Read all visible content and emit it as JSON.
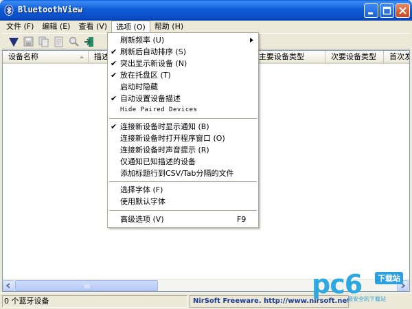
{
  "window": {
    "title": "BluetoothView"
  },
  "menubar": {
    "items": [
      {
        "label": "文件 (F)"
      },
      {
        "label": "编辑 (E)"
      },
      {
        "label": "查看 (V)"
      },
      {
        "label": "选项 (O)"
      },
      {
        "label": "帮助 (H)"
      }
    ],
    "active_index": 3
  },
  "toolbar": {
    "icons": [
      "properties-icon",
      "save-icon",
      "copy-icon",
      "html-report-icon",
      "find-icon",
      "exit-icon"
    ]
  },
  "table": {
    "columns": [
      {
        "label": "设备名称"
      },
      {
        "label": "描述"
      },
      {
        "label": "主要设备类型"
      },
      {
        "label": "次要设备类型"
      },
      {
        "label": "首次发"
      }
    ],
    "rows": []
  },
  "options_menu": {
    "items": [
      {
        "label": "刷新频率 (U)",
        "checked": false,
        "submenu": true
      },
      {
        "label": "刷新后自动排序 (S)",
        "checked": true
      },
      {
        "label": "突出显示新设备 (N)",
        "checked": true
      },
      {
        "label": "放在托盘区 (T)",
        "checked": true
      },
      {
        "label": "启动时隐藏",
        "checked": false
      },
      {
        "label": "自动设置设备描述",
        "checked": true
      },
      {
        "label": "Hide Paired Devices",
        "checked": false
      },
      {
        "separator": true
      },
      {
        "label": "连接新设备时显示通知 (B)",
        "checked": true
      },
      {
        "label": "连接新设备时打开程序窗口 (O)",
        "checked": false
      },
      {
        "label": "连接新设备时声音提示 (R)",
        "checked": false
      },
      {
        "label": "仅通知已知描述的设备",
        "checked": false
      },
      {
        "label": "添加标题行到CSV/Tab分隔的文件",
        "checked": false
      },
      {
        "separator": true
      },
      {
        "label": "选择字体 (F)",
        "checked": false
      },
      {
        "label": "使用默认字体",
        "checked": false
      },
      {
        "separator": true
      },
      {
        "label": "高级选项 (V)",
        "checked": false,
        "shortcut": "F9"
      }
    ]
  },
  "status": {
    "device_count": "0 个蓝牙设备",
    "credit": "NirSoft Freeware.  http://www.nirsoft.net"
  },
  "watermark": {
    "logo": "pc6",
    "badge": "下载站",
    "slogan": "最安全的下载站"
  },
  "colors": {
    "title_blue": "#0a4fc9",
    "menu_highlight": "#ffffff",
    "status_link": "#1a3a94",
    "watermark_blue": "#2fa8e0"
  }
}
